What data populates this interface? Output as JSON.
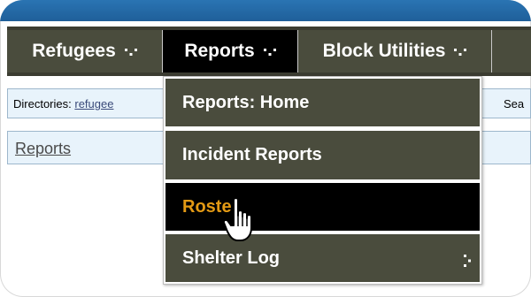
{
  "nav": {
    "items": [
      {
        "label": "Refugees"
      },
      {
        "label": "Reports"
      },
      {
        "label": "Block Utilities"
      }
    ]
  },
  "subrow": {
    "directories_prefix": "Directories: ",
    "directories_link": "refugee",
    "search_label": "Sea"
  },
  "breadcrumb": {
    "label": "Reports"
  },
  "dropdown": {
    "items": [
      {
        "label": "Reports: Home"
      },
      {
        "label": "Incident Reports"
      },
      {
        "label": "Roster"
      },
      {
        "label": "Shelter Log"
      }
    ]
  },
  "colors": {
    "nav_bg": "#4a4c3d",
    "nav_active_bg": "#000000",
    "hover_text": "#e39a14",
    "top_bar": "#1f5f99",
    "row_bg": "#e8f3fb"
  },
  "icons": {
    "nav_arrow": "small-down-arrow-icon",
    "submenu": "submenu-arrow-icon",
    "cursor": "hand-pointer-cursor-icon"
  }
}
